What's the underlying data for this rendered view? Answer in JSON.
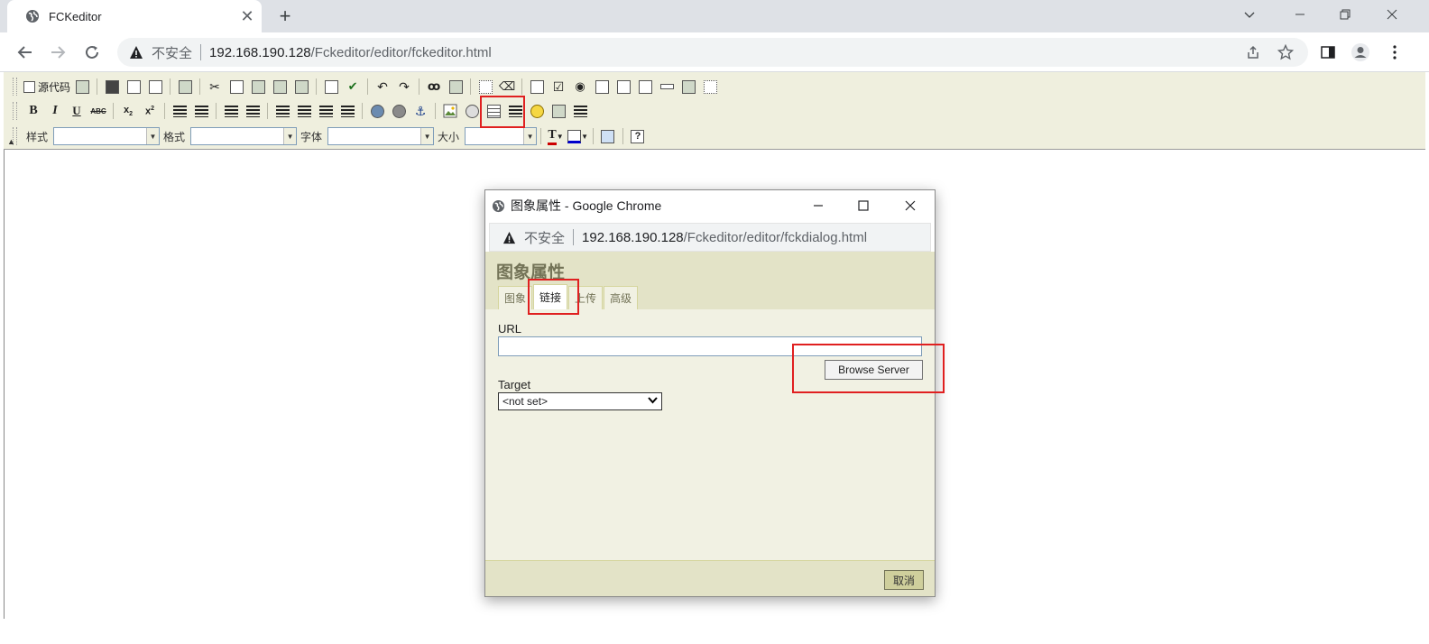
{
  "browser": {
    "tab_title": "FCKeditor",
    "tab_close": "✕",
    "new_tab": "+",
    "insecure_label": "不安全",
    "url_host": "192.168.190.128",
    "url_path": "/Fckeditor/editor/fckeditor.html"
  },
  "fck_toolbar": {
    "source_label": "源代码",
    "style_label": "样式",
    "format_label": "格式",
    "font_label": "字体",
    "size_label": "大小",
    "style_value": "",
    "format_value": "",
    "font_value": "",
    "size_value": "",
    "color_text_label": "T",
    "help_label": "?",
    "abc_label": "ABC",
    "sub_label": "x",
    "sub_script": "2",
    "sup_label": "x",
    "sup_script": "2"
  },
  "popup": {
    "window_title": "图象属性 - Google Chrome",
    "insecure_label": "不安全",
    "url_host": "192.168.190.128",
    "url_path": "/Fckeditor/editor/fckdialog.html"
  },
  "dialog": {
    "title": "图象属性",
    "tabs": [
      {
        "label": "图象"
      },
      {
        "label": "链接"
      },
      {
        "label": "上传"
      },
      {
        "label": "高级"
      }
    ],
    "url_label": "URL",
    "url_value": "",
    "browse_button": "Browse Server",
    "target_label": "Target",
    "target_value": "<not set>",
    "cancel_button": "取消"
  },
  "colors": {
    "highlight": "#e02020",
    "dialog_bg": "#f1f1e3",
    "dialog_head": "#e3e3c7",
    "toolbar_bg": "#efefde"
  }
}
